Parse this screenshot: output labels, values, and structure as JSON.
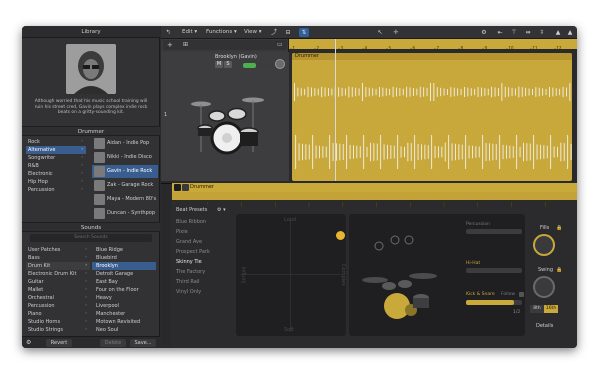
{
  "library": {
    "title": "Library",
    "description": "Although worried that his music school training will ruin his street cred, Gavin plays complex indie rock beats on a gritty-sounding kit.",
    "drummer_header": "Drummer",
    "genres": [
      "Rock",
      "Alternative",
      "Songwriter",
      "R&B",
      "Electronic",
      "Hip Hop",
      "Percussion"
    ],
    "selected_genre": "Alternative",
    "drummers": [
      "Aidan - Indie Pop",
      "Nikki - Indie Disco",
      "Gavin - Indie Rock",
      "Zak - Garage Rock",
      "Maya - Modern 80's",
      "Duncan - Synthpop"
    ],
    "selected_drummer": "Gavin - Indie Rock",
    "sounds_header": "Sounds",
    "sounds_search_placeholder": "Search Sounds",
    "patch_categories": [
      "User Patches",
      "Bass",
      "Drum Kit",
      "Electronic Drum Kit",
      "Guitar",
      "Mallet",
      "Orchestral",
      "Percussion",
      "Piano",
      "Studio Horns",
      "Studio Strings"
    ],
    "selected_category": "Drum Kit",
    "patches": [
      "Blue Ridge",
      "Bluebird",
      "Brooklyn",
      "Detroit Garage",
      "East Bay",
      "Four on the Floor",
      "Heavy",
      "Liverpool",
      "Manchester",
      "Motown Revisited",
      "Neo Soul"
    ],
    "selected_patch": "Brooklyn",
    "footer": {
      "revert": "Revert",
      "delete": "Delete",
      "save": "Save..."
    }
  },
  "toolbar": {
    "edit": "Edit",
    "functions": "Functions",
    "view": "View"
  },
  "track": {
    "name": "Brooklyn (Gavin)",
    "mute": "M",
    "solo": "S",
    "number": "1",
    "volume_level": 0.45
  },
  "region": {
    "name": "Drummer"
  },
  "ruler_marks": [
    "1",
    "2",
    "3",
    "4",
    "5",
    "6",
    "7",
    "8",
    "9",
    "10",
    "11",
    "12"
  ],
  "editor": {
    "header": "Drummer",
    "ruler_marks": [
      "1",
      "2",
      "3",
      "4",
      "5",
      "6",
      "7",
      "8",
      "9",
      "10",
      "11",
      "12"
    ],
    "presets_header": "Beat Presets",
    "presets": [
      "Blue Ribbon",
      "Pixie",
      "Grand Ave",
      "Prospect Park",
      "Skinny Tie",
      "The Factory",
      "Third Rail",
      "Vinyl Only"
    ],
    "selected_preset": "Skinny Tie",
    "xy_labels": {
      "top": "Loud",
      "bottom": "Soft",
      "left": "Simple",
      "right": "Complex"
    },
    "percussion_label": "Percussion",
    "hihat_label": "Hi-Hat",
    "kick_snare_label": "Kick & Snare",
    "follow_label": "Follow",
    "fills_label": "Fills",
    "swing_label": "Swing",
    "swing_options": [
      "8th",
      "16th"
    ],
    "selected_swing": "16th",
    "details_label": "Details",
    "fraction_label": "1/2",
    "levels": {
      "percussion": 0.0,
      "hihat": 0.0,
      "kick_snare": 0.85
    }
  },
  "colors": {
    "accent": "#c9a93a",
    "selection": "#3a5d8f",
    "background": "#2a2a2c"
  }
}
